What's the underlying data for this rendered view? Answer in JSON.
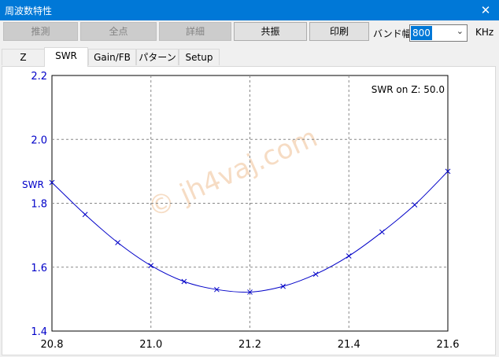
{
  "window": {
    "title": "周波数特性",
    "close_glyph": "✕"
  },
  "toolbar": {
    "buttons": [
      {
        "label": "推測",
        "enabled": false
      },
      {
        "label": "全点",
        "enabled": false
      },
      {
        "label": "詳細",
        "enabled": false
      },
      {
        "label": "共振",
        "enabled": true
      },
      {
        "label": "印刷",
        "enabled": true
      }
    ],
    "band_label": "バンド幅",
    "band_value": "800",
    "unit": "KHz"
  },
  "tabs": [
    {
      "label": "Z",
      "active": false
    },
    {
      "label": "SWR",
      "active": true
    },
    {
      "label": "Gain/FB",
      "active": false
    },
    {
      "label": "パターン",
      "active": false
    },
    {
      "label": "Setup",
      "active": false
    }
  ],
  "chart_data": {
    "type": "line",
    "ylabel": "SWR",
    "annotation": "SWR on Z: 50.0",
    "watermark": "© jh4vaj.com",
    "xlim": [
      20.8,
      21.6
    ],
    "ylim": [
      1.4,
      2.2
    ],
    "x_ticks": [
      "20.8",
      "21.0",
      "21.2",
      "21.4",
      "21.6"
    ],
    "y_ticks": [
      "1.4",
      "1.6",
      "1.8",
      "2.0",
      "2.2"
    ],
    "grid": true,
    "color": "#0000c8",
    "series": [
      {
        "x": [
          20.8,
          20.867,
          20.933,
          21.0,
          21.067,
          21.133,
          21.2,
          21.267,
          21.333,
          21.4,
          21.467,
          21.533,
          21.6
        ],
        "y": [
          1.865,
          1.765,
          1.677,
          1.605,
          1.555,
          1.53,
          1.522,
          1.54,
          1.578,
          1.635,
          1.71,
          1.795,
          1.9
        ]
      }
    ]
  }
}
